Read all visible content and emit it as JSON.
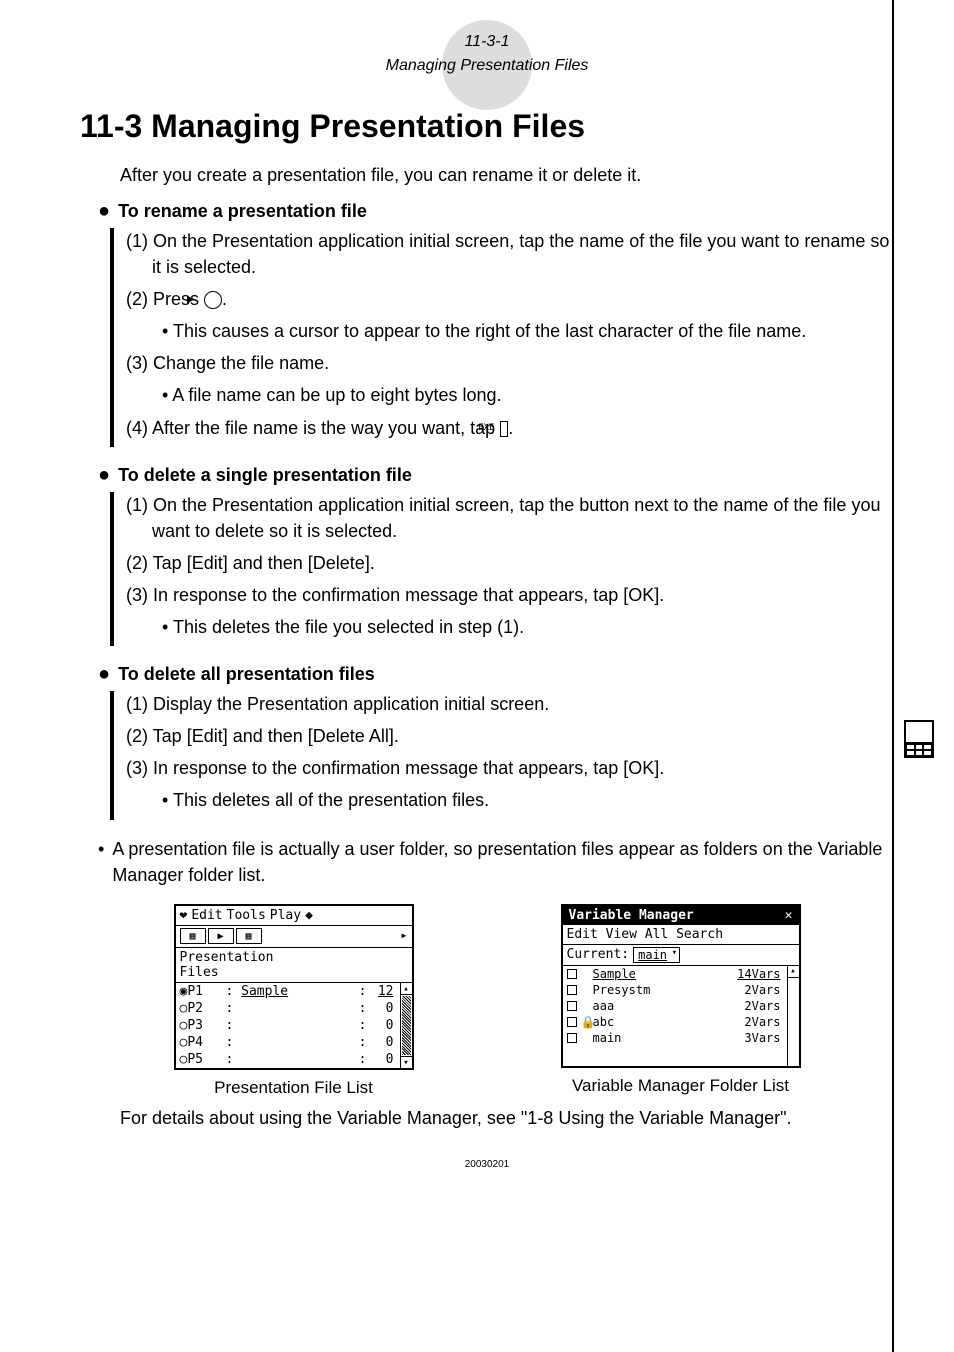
{
  "header": {
    "ref": "11-3-1",
    "title": "Managing Presentation Files"
  },
  "h1": "11-3 Managing Presentation Files",
  "intro": "After you create a presentation file, you can rename it or delete it.",
  "sec_rename": {
    "title": "To rename a presentation file",
    "s1": "(1) On the Presentation application initial screen, tap the name of the file you want to rename so it is selected.",
    "s2a": "(2) Press ",
    "s2b": ".",
    "s2_sub": "• This causes a cursor to appear to the right of the last character of the file name.",
    "s3": "(3) Change the file name.",
    "s3_sub": "• A file name can be up to eight bytes long.",
    "s4a": "(4) After the file name is the way you want, tap ",
    "s4b": "."
  },
  "sec_delete_one": {
    "title": "To delete a single presentation file",
    "s1": "(1) On the Presentation application initial screen, tap the button next to the name of the file you want to delete so it is selected.",
    "s2": "(2) Tap [Edit] and then [Delete].",
    "s3": "(3) In response to the confirmation message that appears, tap [OK].",
    "s3_sub": "• This deletes the file you selected in step (1)."
  },
  "sec_delete_all": {
    "title": "To delete all presentation files",
    "s1": "(1) Display the Presentation application initial screen.",
    "s2": "(2) Tap [Edit] and then [Delete All].",
    "s3": "(3) In response to the confirmation message that appears, tap [OK].",
    "s3_sub": "• This deletes all of the presentation files."
  },
  "note": "A presentation file is actually a user folder, so presentation files appear as folders on the Variable Manager folder list.",
  "fig1": {
    "menu": {
      "edit": "Edit",
      "tools": "Tools",
      "play": "Play"
    },
    "header1": "Presentation",
    "header2": "Files",
    "rows": [
      {
        "radio": "◉",
        "lbl": "P1",
        "name": "Sample",
        "val": "12"
      },
      {
        "radio": "○",
        "lbl": "P2",
        "name": "",
        "val": "0"
      },
      {
        "radio": "○",
        "lbl": "P3",
        "name": "",
        "val": "0"
      },
      {
        "radio": "○",
        "lbl": "P4",
        "name": "",
        "val": "0"
      },
      {
        "radio": "○",
        "lbl": "P5",
        "name": "",
        "val": "0"
      }
    ],
    "caption": "Presentation File List"
  },
  "fig2": {
    "title": "Variable Manager",
    "menu": "Edit View All Search",
    "current_label": "Current:",
    "current_value": "main",
    "rows": [
      {
        "lock": "",
        "name": "Sample",
        "vars": "14Vars"
      },
      {
        "lock": "",
        "name": "Presystm",
        "vars": "2Vars"
      },
      {
        "lock": "",
        "name": "aaa",
        "vars": "2Vars"
      },
      {
        "lock": "🔒",
        "name": "abc",
        "vars": "2Vars"
      },
      {
        "lock": "",
        "name": "main",
        "vars": "3Vars"
      }
    ],
    "caption": "Variable Manager Folder List"
  },
  "closing": "For details about using the Variable Manager, see \"1-8 Using the Variable Manager\".",
  "footer": "20030201",
  "exe_label": "EXE"
}
